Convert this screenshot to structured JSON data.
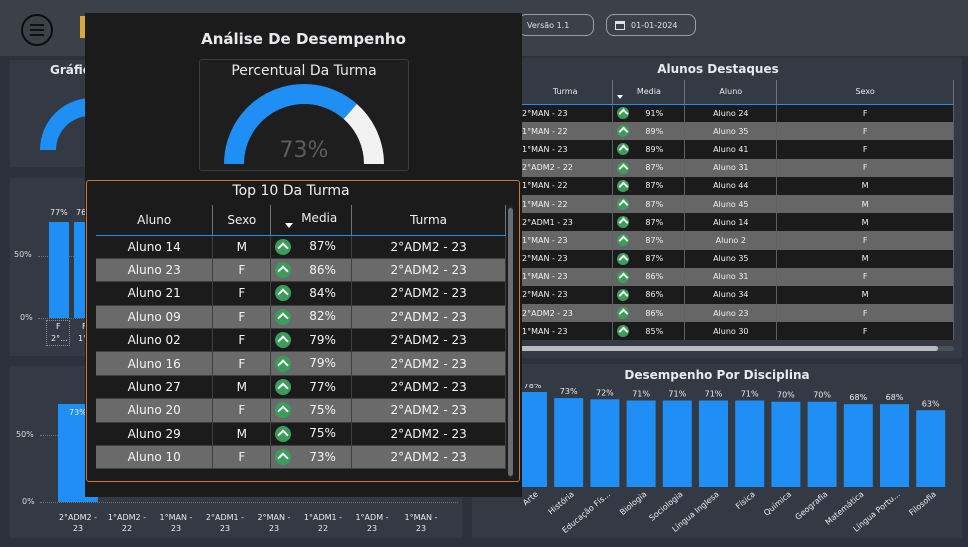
{
  "header": {
    "version": "Versão 1.1",
    "date": "01-01-2024"
  },
  "left_gauge_panel": {
    "title_partial": "Gráfic"
  },
  "left_bars_top": {
    "labels": [
      "77%",
      "76"
    ],
    "ytick_50": "50%",
    "ytick_0": "0%",
    "xcat_1": "F",
    "xcat_1b": "2°...",
    "xcat_2": "F",
    "xcat_2b": "1°"
  },
  "bottom_left_chart": {
    "ytick_50": "50%",
    "ytick_0": "0%",
    "first_label": "73%",
    "categories": [
      [
        "2°ADM2 -",
        "23"
      ],
      [
        "1°ADM2 -",
        "22"
      ],
      [
        "1°MAN -",
        "23"
      ],
      [
        "2°ADM1 -",
        "23"
      ],
      [
        "2°MAN -",
        "23"
      ],
      [
        "1°ADM1 -",
        "22"
      ],
      [
        "1°ADM -",
        "23"
      ],
      [
        "1°MAN -",
        "23"
      ]
    ]
  },
  "alunos_destaques": {
    "title": "Alunos Destaques",
    "columns": [
      "Turma",
      "Media",
      "Aluno",
      "Sexo"
    ],
    "rows": [
      [
        "2°MAN - 23",
        "91%",
        "Aluno 24",
        "F"
      ],
      [
        "1°MAN - 22",
        "89%",
        "Aluno 35",
        "F"
      ],
      [
        "1°MAN - 23",
        "89%",
        "Aluno 41",
        "F"
      ],
      [
        "2°ADM2 - 22",
        "87%",
        "Aluno 31",
        "F"
      ],
      [
        "1°MAN - 22",
        "87%",
        "Aluno 44",
        "M"
      ],
      [
        "1°MAN - 22",
        "87%",
        "Aluno 45",
        "M"
      ],
      [
        "2°ADM1 - 23",
        "87%",
        "Aluno 14",
        "M"
      ],
      [
        "1°MAN - 23",
        "87%",
        "Aluno 2",
        "F"
      ],
      [
        "2°MAN - 23",
        "87%",
        "Aluno 35",
        "M"
      ],
      [
        "1°MAN - 23",
        "86%",
        "Aluno 31",
        "F"
      ],
      [
        "2°MAN - 23",
        "86%",
        "Aluno 34",
        "M"
      ],
      [
        "2°ADM2 - 23",
        "86%",
        "Aluno 23",
        "F"
      ],
      [
        "1°MAN - 23",
        "85%",
        "Aluno 30",
        "F"
      ]
    ]
  },
  "desempenho_disciplina": {
    "title": "Desempenho Por Disciplina",
    "chart_data": {
      "type": "bar",
      "title": "Desempenho Por Disciplina",
      "categories": [
        "Arte",
        "História",
        "Educação Fís...",
        "Biologia",
        "Sociologia",
        "Língua Inglesa",
        "Física",
        "Química",
        "Geografia",
        "Matemática",
        "Língua Portu...",
        "Filosofia"
      ],
      "values": [
        78,
        73,
        72,
        71,
        71,
        71,
        71,
        70,
        70,
        68,
        68,
        63
      ],
      "labels": [
        "78%",
        "73%",
        "72%",
        "71%",
        "71%",
        "71%",
        "71%",
        "70%",
        "70%",
        "68%",
        "68%",
        "63%"
      ],
      "ylim": [
        0,
        100
      ]
    }
  },
  "overlay": {
    "title": "Análise De Desempenho",
    "gauge_title": "Percentual Da Turma",
    "gauge_value": 0.73,
    "gauge_label": "73%",
    "top10_title": "Top 10 Da Turma",
    "columns": [
      "Aluno",
      "Sexo",
      "Media",
      "Turma"
    ],
    "rows": [
      [
        "Aluno 14",
        "M",
        "87%",
        "2°ADM2 - 23"
      ],
      [
        "Aluno 23",
        "F",
        "86%",
        "2°ADM2 - 23"
      ],
      [
        "Aluno 21",
        "F",
        "84%",
        "2°ADM2 - 23"
      ],
      [
        "Aluno 09",
        "F",
        "82%",
        "2°ADM2 - 23"
      ],
      [
        "Aluno 02",
        "F",
        "79%",
        "2°ADM2 - 23"
      ],
      [
        "Aluno 16",
        "F",
        "79%",
        "2°ADM2 - 23"
      ],
      [
        "Aluno 27",
        "M",
        "77%",
        "2°ADM2 - 23"
      ],
      [
        "Aluno 20",
        "F",
        "75%",
        "2°ADM2 - 23"
      ],
      [
        "Aluno 29",
        "M",
        "75%",
        "2°ADM2 - 23"
      ],
      [
        "Aluno 10",
        "F",
        "73%",
        "2°ADM2 - 23"
      ]
    ]
  },
  "colors": {
    "accent": "#1f8ff5",
    "background": "#2b323c",
    "panel": "#333a43",
    "overlay": "#1b1b1b",
    "kpi_up": "#3a9e5a"
  }
}
